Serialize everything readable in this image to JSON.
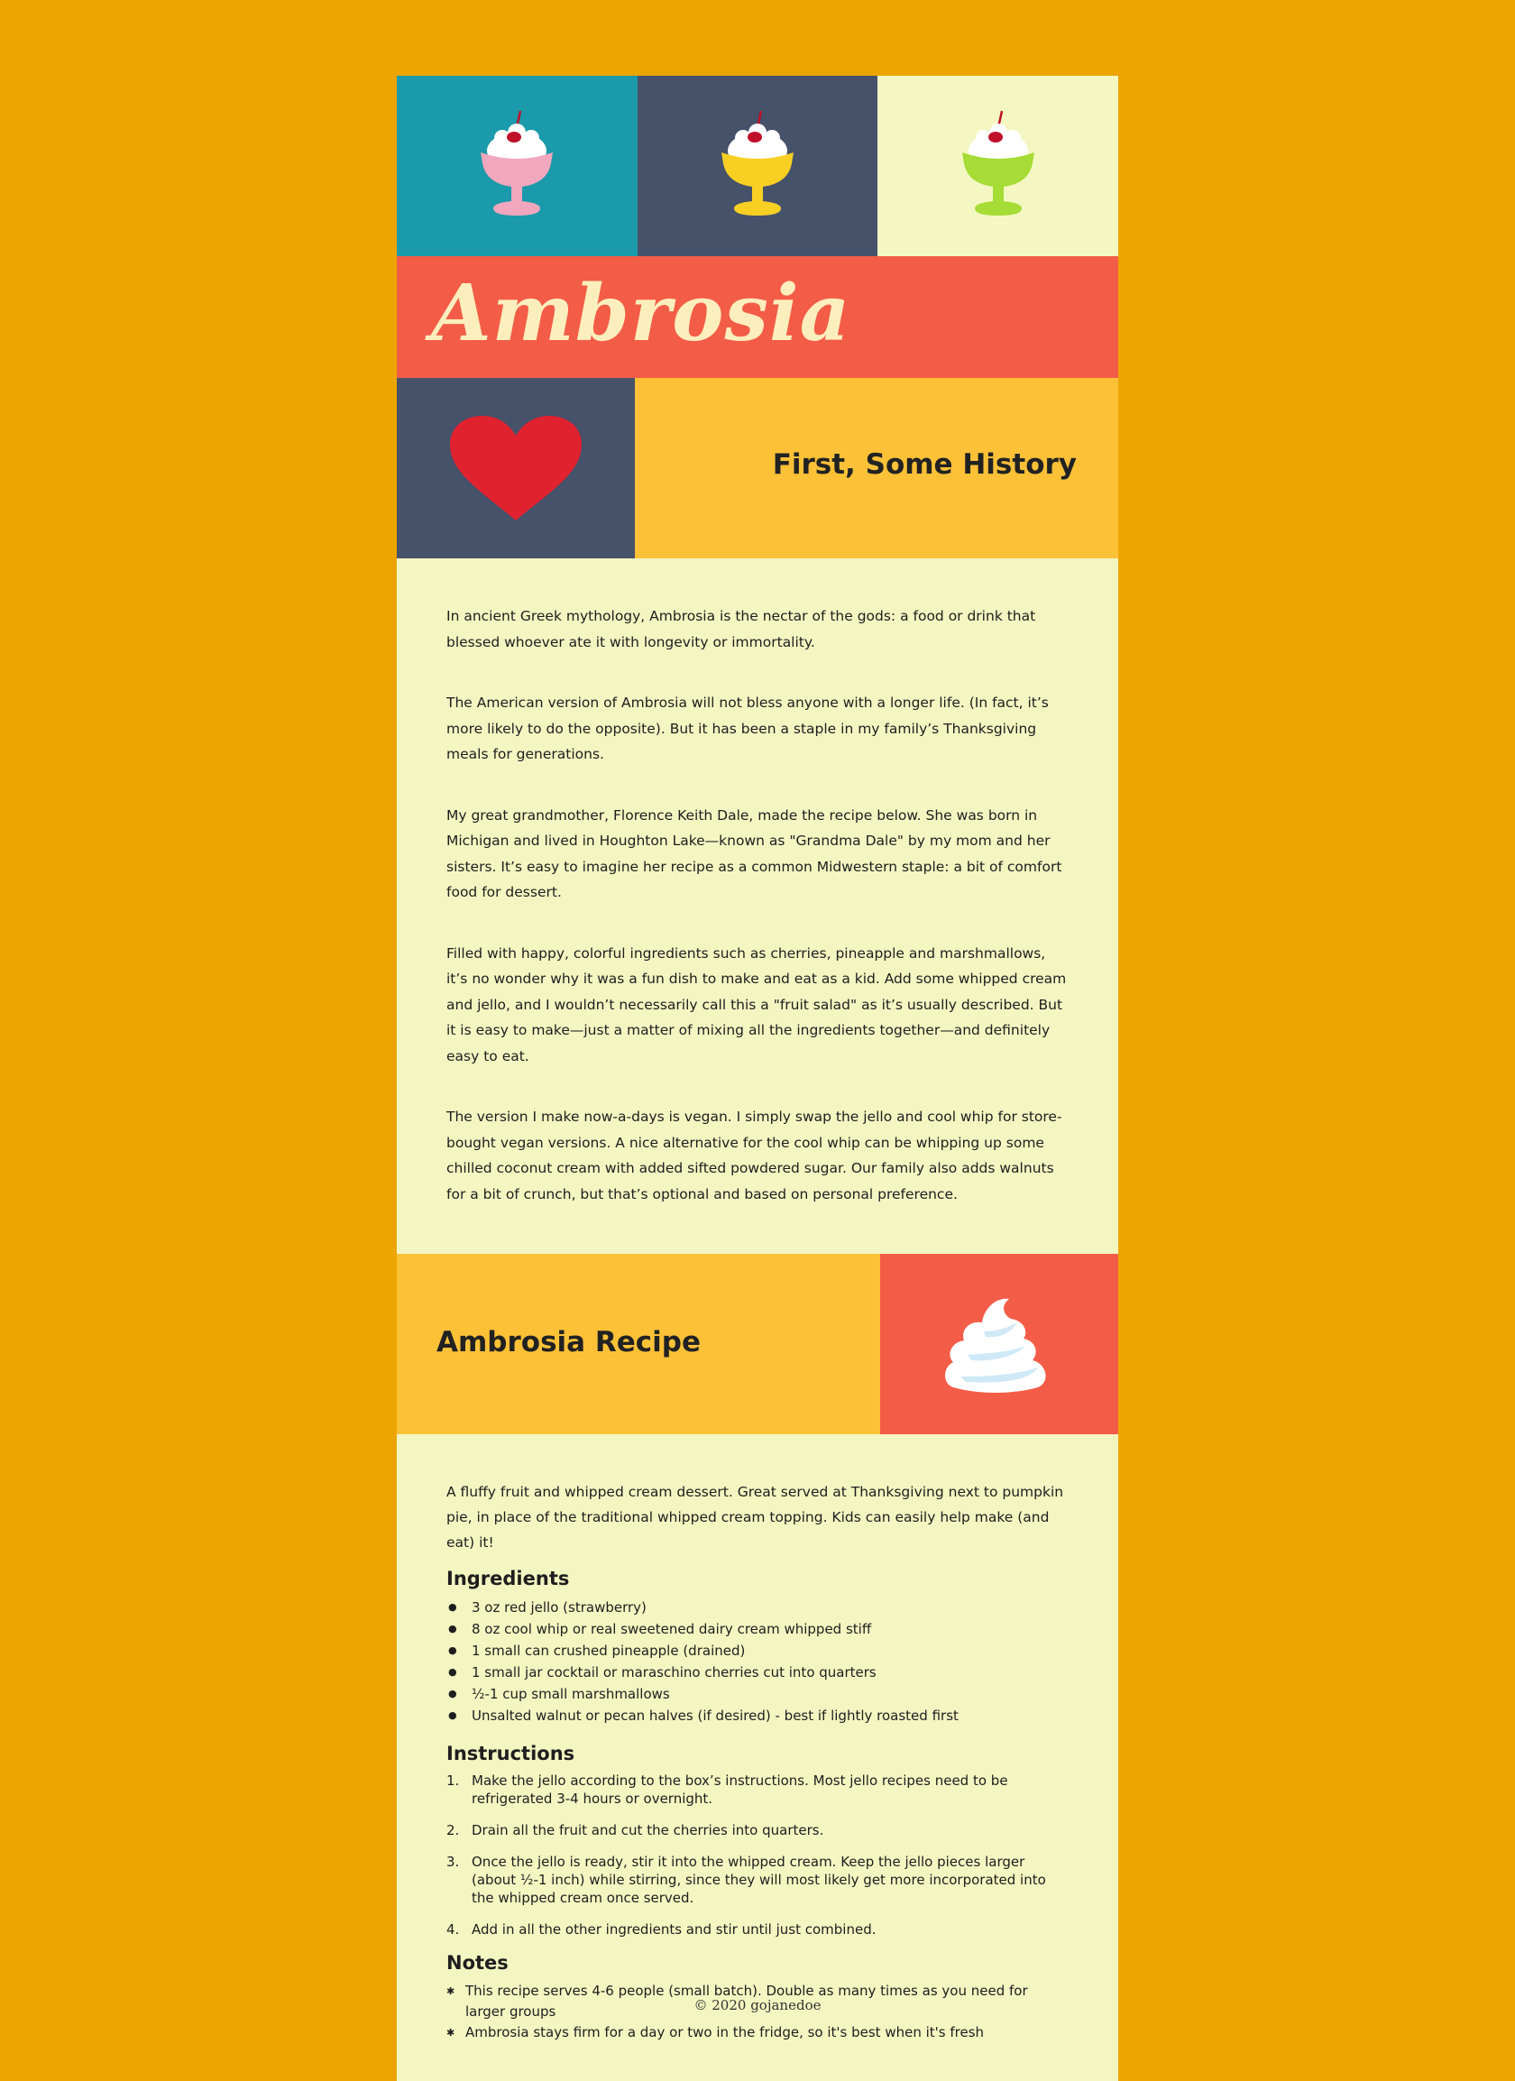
{
  "header": {
    "title": "Ambrosia",
    "tile_colors": [
      "#1a9aab",
      "#46516a",
      "#f4f7c2"
    ],
    "cup_colors": [
      "#f1a7bd",
      "#f8d024",
      "#a5dc35"
    ],
    "icons": [
      "sundae-icon",
      "sundae-icon",
      "sundae-icon"
    ]
  },
  "history": {
    "heading": "First, Some History",
    "icon": "heart-icon",
    "paragraphs": [
      "In ancient Greek mythology, Ambrosia is the nectar of the gods: a food or drink that blessed whoever ate it with longevity or immortality.",
      "The American version of Ambrosia will not bless anyone with a longer life. (In fact, it’s more likely to do the opposite). But it has been a staple in my family’s Thanksgiving meals for generations.",
      "My great grandmother, Florence Keith Dale, made the recipe below. She was born in Michigan and lived in Houghton Lake—known as \"Grandma Dale\" by my mom and her sisters. It’s easy to imagine her recipe as a common Midwestern staple: a bit of comfort food for dessert.",
      "Filled with happy, colorful ingredients such as cherries, pineapple and marshmallows, it’s no wonder why it was a fun dish to make and eat as a kid. Add some whipped cream and jello, and I wouldn’t necessarily call this a \"fruit salad\" as it’s usually described. But it is easy to make—just a matter of mixing all the ingredients together—and definitely easy to eat.",
      "The version I make now-a-days is vegan. I simply swap the jello and cool whip for store-bought vegan versions. A nice alternative for the cool whip can be whipping up some chilled coconut cream with added sifted powdered sugar. Our family also adds walnuts for a bit of crunch, but that’s optional and based on personal preference."
    ]
  },
  "recipe": {
    "heading": "Ambrosia Recipe",
    "icon": "whipped-cream-icon",
    "intro": "A fluffy fruit and whipped cream dessert. Great served at Thanksgiving next to pumpkin pie, in place of the traditional whipped cream topping. Kids can easily help make (and eat) it!",
    "ingredients_heading": "Ingredients",
    "ingredients": [
      "3 oz red jello (strawberry)",
      "8 oz cool whip or real sweetened dairy cream whipped stiff",
      "1 small can crushed pineapple (drained)",
      "1 small jar cocktail or maraschino cherries cut into quarters",
      "½-1 cup small marshmallows",
      "Unsalted walnut or pecan halves (if desired) - best if lightly roasted first"
    ],
    "instructions_heading": "Instructions",
    "instructions": [
      {
        "num": "1.",
        "text": "Make the jello according to the box’s instructions. Most jello recipes need to be refrigerated 3-4 hours or overnight."
      },
      {
        "num": "2.",
        "text": "Drain all the fruit and cut the cherries into quarters."
      },
      {
        "num": "3.",
        "text": "Once the jello is ready, stir it into the whipped cream. Keep the jello pieces larger (about ½-1 inch) while stirring, since they will most likely get more incorporated into the whipped cream once served."
      },
      {
        "num": "4.",
        "text": "Add in all the other ingredients and stir until just combined."
      }
    ],
    "notes_heading": "Notes",
    "notes": [
      "This recipe serves 4-6 people (small batch). Double as many times as you need for larger groups",
      "Ambrosia stays firm for a day or two in the fridge, so it's best when it's fresh"
    ]
  },
  "footer": {
    "copyright": "© 2020 gojanedoe"
  }
}
